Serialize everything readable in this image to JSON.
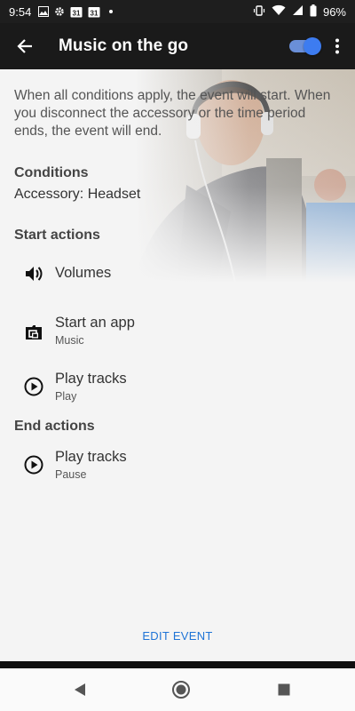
{
  "status_bar": {
    "time": "9:54",
    "cal_day_1": "31",
    "cal_day_2": "31",
    "battery": "96%"
  },
  "app_bar": {
    "title": "Music on the go",
    "toggle_on": true
  },
  "description": "When all conditions apply, the event will start. When you disconnect the accessory or the time period ends, the event will end.",
  "conditions": {
    "title": "Conditions",
    "accessory": "Accessory: Headset"
  },
  "start_actions": {
    "title": "Start actions",
    "items": [
      {
        "label": "Volumes",
        "sub": "",
        "icon": "volume-icon"
      },
      {
        "label": "Start an app",
        "sub": "Music",
        "icon": "app-icon"
      },
      {
        "label": "Play tracks",
        "sub": "Play",
        "icon": "play-circle-icon"
      }
    ]
  },
  "end_actions": {
    "title": "End actions",
    "items": [
      {
        "label": "Play tracks",
        "sub": "Pause",
        "icon": "play-circle-icon"
      }
    ]
  },
  "edit_event": "EDIT EVENT",
  "colors": {
    "accent": "#1f74d6",
    "toggle": "#3d7cf0",
    "appbar": "#1a1a1a"
  }
}
